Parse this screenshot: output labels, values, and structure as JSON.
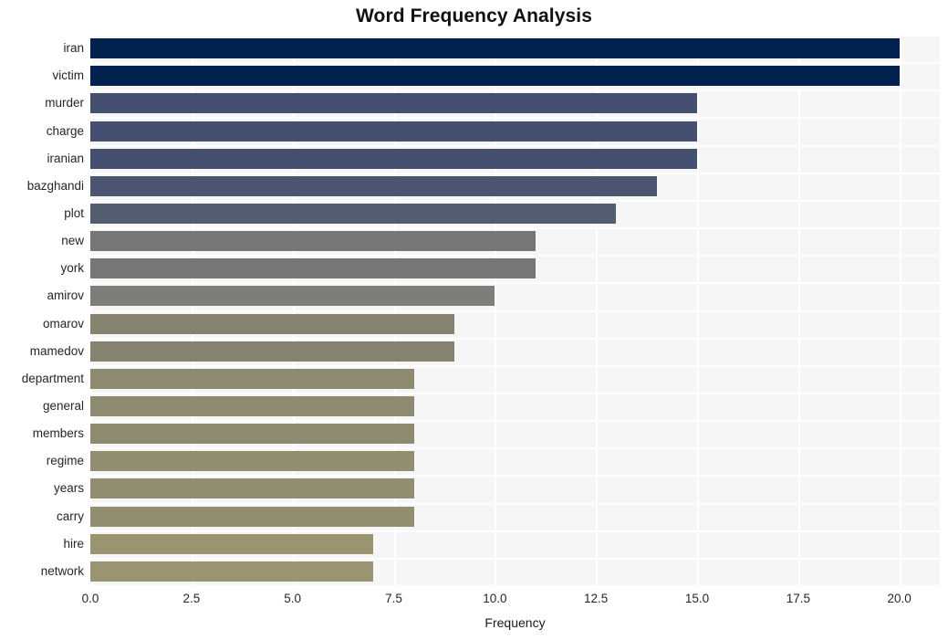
{
  "chart_data": {
    "type": "bar",
    "orientation": "horizontal",
    "title": "Word Frequency Analysis",
    "xlabel": "Frequency",
    "ylabel": "",
    "xlim": [
      0.0,
      21.0
    ],
    "xticks": [
      "0.0",
      "2.5",
      "5.0",
      "7.5",
      "10.0",
      "12.5",
      "15.0",
      "17.5",
      "20.0"
    ],
    "xtick_values": [
      0.0,
      2.5,
      5.0,
      7.5,
      10.0,
      12.5,
      15.0,
      17.5,
      20.0
    ],
    "grid": true,
    "legend": "none",
    "categories": [
      "iran",
      "victim",
      "murder",
      "charge",
      "iranian",
      "bazghandi",
      "plot",
      "new",
      "york",
      "amirov",
      "omarov",
      "mamedov",
      "department",
      "general",
      "members",
      "regime",
      "years",
      "carry",
      "hire",
      "network"
    ],
    "values": [
      20,
      20,
      15,
      15,
      15,
      14,
      13,
      11,
      11,
      10,
      9,
      9,
      8,
      8,
      8,
      8,
      8,
      8,
      7,
      7
    ],
    "bar_colors": [
      "#00214e",
      "#00214e",
      "#454f70",
      "#454f70",
      "#454f70",
      "#4c5570",
      "#545c70",
      "#767676",
      "#767676",
      "#7d7d79",
      "#85836f",
      "#85836f",
      "#8e8b71",
      "#8e8b71",
      "#8e8b71",
      "#918e72",
      "#918e72",
      "#918e72",
      "#9b9471",
      "#9b9471"
    ],
    "plot_background": "#f6f6f6",
    "gridline_color": "#ffffff",
    "figure_background": "#ffffff"
  }
}
